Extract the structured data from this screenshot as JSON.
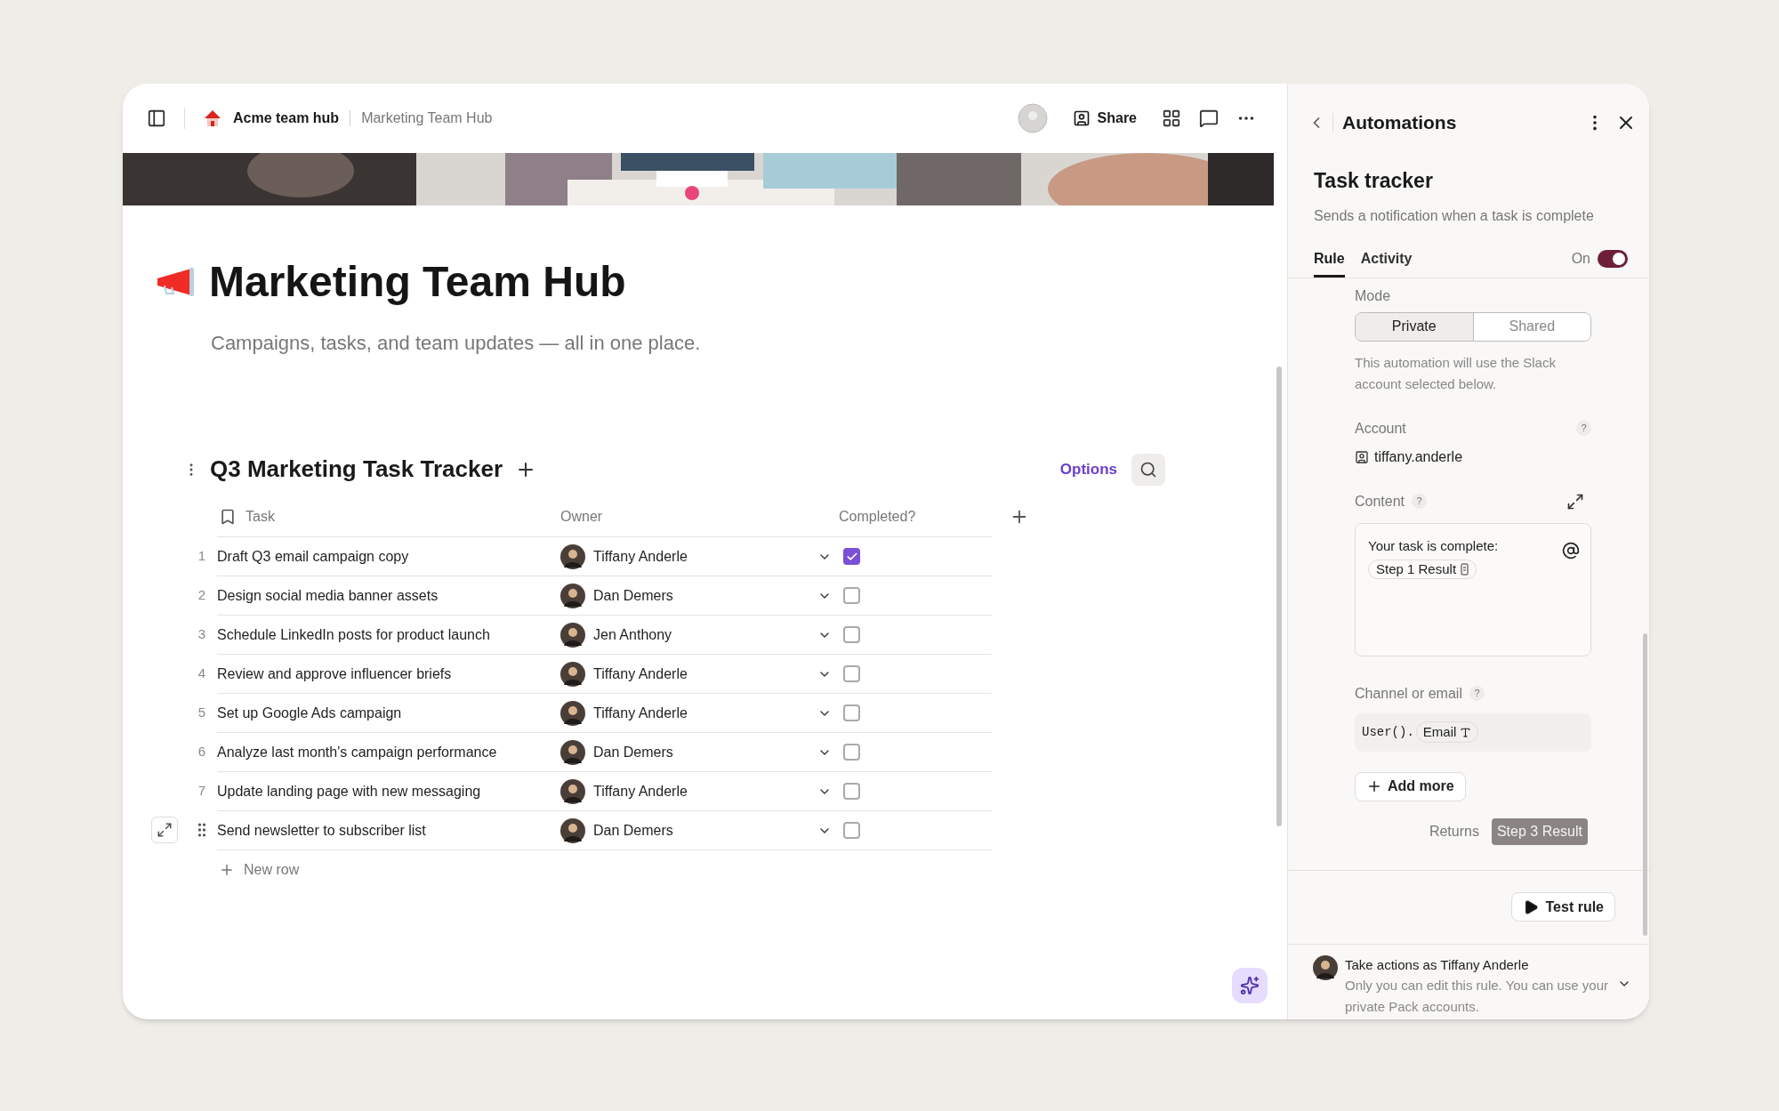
{
  "topbar": {
    "workspace": "Acme team hub",
    "page": "Marketing Team Hub",
    "share": "Share"
  },
  "page": {
    "title": "Marketing Team Hub",
    "subtitle": "Campaigns, tasks, and team updates — all in one place."
  },
  "table": {
    "title": "Q3 Marketing Task Tracker",
    "options": "Options",
    "columns": [
      "Task",
      "Owner",
      "Completed?"
    ],
    "rows": [
      {
        "number": "1",
        "task": "Draft Q3 email campaign copy",
        "owner": "Tiffany Anderle",
        "completed": true,
        "hovered": false
      },
      {
        "number": "2",
        "task": "Design social media banner assets",
        "owner": "Dan Demers",
        "completed": false,
        "hovered": false
      },
      {
        "number": "3",
        "task": "Schedule LinkedIn posts for product launch",
        "owner": "Jen Anthony",
        "completed": false,
        "hovered": false
      },
      {
        "number": "4",
        "task": "Review and approve influencer briefs",
        "owner": "Tiffany Anderle",
        "completed": false,
        "hovered": false
      },
      {
        "number": "5",
        "task": "Set up Google Ads campaign",
        "owner": "Tiffany Anderle",
        "completed": false,
        "hovered": false
      },
      {
        "number": "6",
        "task": "Analyze last month's campaign performance",
        "owner": "Dan Demers",
        "completed": false,
        "hovered": false
      },
      {
        "number": "7",
        "task": "Update landing page with new messaging",
        "owner": "Tiffany Anderle",
        "completed": false,
        "hovered": false
      },
      {
        "task": "Send newsletter to subscriber list",
        "owner": "Dan Demers",
        "completed": false,
        "hovered": true
      }
    ],
    "new_row": "New row"
  },
  "panel": {
    "title": "Automations",
    "rule_title": "Task tracker",
    "rule_description": "Sends a notification when a task is complete",
    "tabs": [
      {
        "label": "Rule",
        "selected": true
      },
      {
        "label": "Activity",
        "selected": false
      }
    ],
    "toggle": {
      "label": "On",
      "on": true
    },
    "mode": {
      "label": "Mode",
      "options": [
        {
          "label": "Private",
          "selected": true
        },
        {
          "label": "Shared",
          "selected": false
        }
      ],
      "note": "This automation will use the Slack account selected below."
    },
    "account": {
      "label": "Account",
      "help": "?",
      "value": "tiffany.anderle"
    },
    "content": {
      "label": "Content",
      "help": "?",
      "text": "Your task is complete:",
      "chip": "Step 1 Result"
    },
    "channel": {
      "label": "Channel or email",
      "help": "?",
      "code": "User().",
      "chip": "Email"
    },
    "add_more": "Add more",
    "returns": {
      "label": "Returns",
      "chip": "Step 3 Result"
    },
    "test_rule": "Test rule",
    "footer": {
      "title": "Take actions as Tiffany Anderle",
      "note": "Only you can edit this rule. You can use your private Pack accounts."
    }
  }
}
